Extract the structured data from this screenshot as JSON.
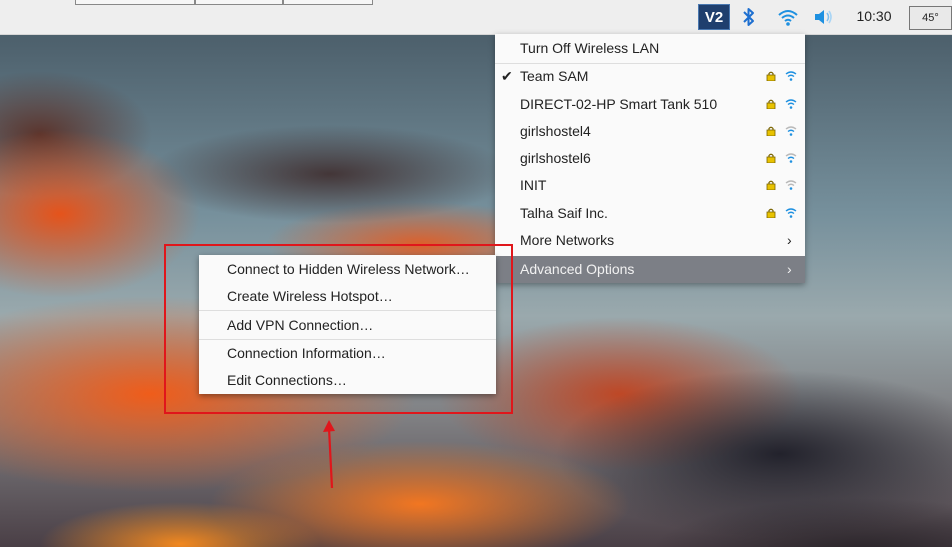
{
  "taskbar": {
    "vnc_label": "V2",
    "clock": "10:30",
    "temperature": "45°"
  },
  "network_menu": {
    "turn_off": "Turn Off Wireless LAN",
    "networks": [
      {
        "ssid": "Team SAM",
        "connected": true,
        "secured": true,
        "signal": "full"
      },
      {
        "ssid": "DIRECT-02-HP Smart Tank 510",
        "connected": false,
        "secured": true,
        "signal": "full"
      },
      {
        "ssid": "girlshostel4",
        "connected": false,
        "secured": true,
        "signal": "weak"
      },
      {
        "ssid": "girlshostel6",
        "connected": false,
        "secured": true,
        "signal": "weak"
      },
      {
        "ssid": "INIT",
        "connected": false,
        "secured": true,
        "signal": "weak"
      },
      {
        "ssid": "Talha Saif Inc.",
        "connected": false,
        "secured": true,
        "signal": "full"
      }
    ],
    "more_networks": "More Networks",
    "advanced_options": "Advanced Options"
  },
  "advanced_submenu": {
    "items": [
      "Connect to Hidden Wireless Network…",
      "Create Wireless Hotspot…",
      "Add VPN Connection…",
      "Connection Information…",
      "Edit Connections…"
    ]
  },
  "colors": {
    "highlight": "#e0161b",
    "selected_item": "#7c7f86",
    "lock": "#e8c200",
    "signal": "#1e90e0"
  }
}
